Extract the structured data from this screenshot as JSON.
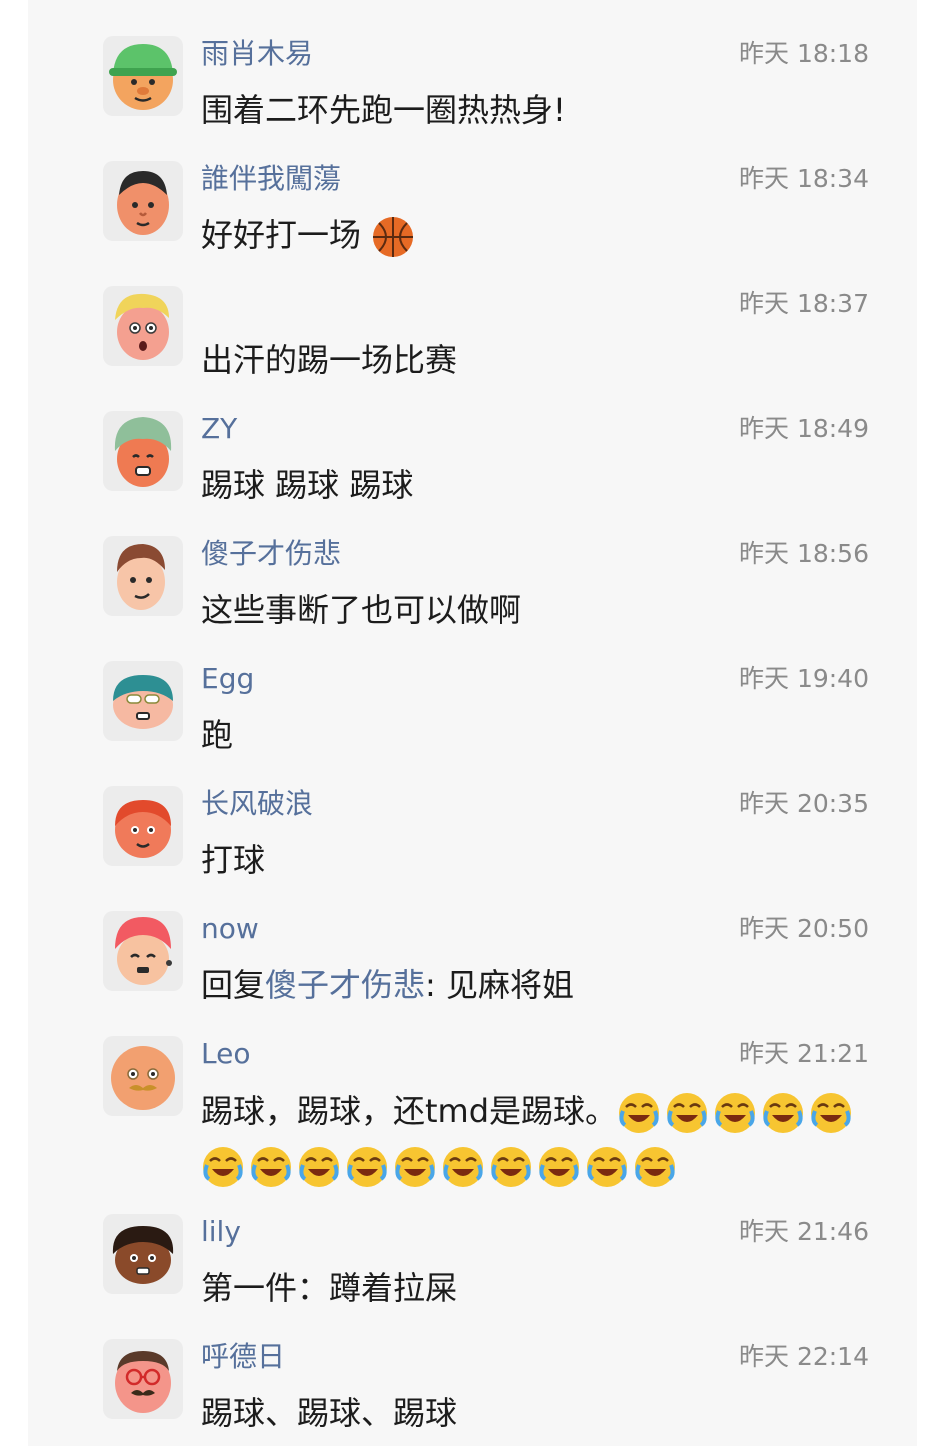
{
  "comments": [
    {
      "name": "雨肖木易",
      "time": "昨天 18:18",
      "text": "围着二环先跑一圈热热身!",
      "avatar": {
        "icon": "avatar-green-cap",
        "skin": "#f3a45f",
        "hair": "#5cc36a"
      }
    },
    {
      "name": "誰伴我闖蕩",
      "time": "昨天 18:34",
      "text": "好好打一场",
      "emoji": "basketball",
      "avatar": {
        "icon": "avatar-black-hair",
        "skin": "#f0906a",
        "hair": "#2a2a2a"
      }
    },
    {
      "name": "",
      "time": "昨天 18:37",
      "text": "出汗的踢一场比赛",
      "avatar": {
        "icon": "avatar-blonde",
        "skin": "#f4a090",
        "hair": "#f0d45a"
      }
    },
    {
      "name": "ZY",
      "time": "昨天 18:49",
      "text": "踢球 踢球 踢球",
      "avatar": {
        "icon": "avatar-turban",
        "skin": "#ef7a52",
        "hair": "#8fbf9a"
      }
    },
    {
      "name": "傻子才伤悲",
      "time": "昨天 18:56",
      "text": "这些事断了也可以做啊",
      "avatar": {
        "icon": "avatar-brown-hair",
        "skin": "#f7c5a8",
        "hair": "#8a4a32"
      }
    },
    {
      "name": "Egg",
      "time": "昨天 19:40",
      "text": "跑",
      "avatar": {
        "icon": "avatar-teal-hair",
        "skin": "#f6b9a2",
        "hair": "#2d8f93"
      }
    },
    {
      "name": "长风破浪",
      "time": "昨天 20:35",
      "text": "打球",
      "avatar": {
        "icon": "avatar-red-hair",
        "skin": "#f07a5a",
        "hair": "#e24a2c"
      }
    },
    {
      "name": "now",
      "time": "昨天 20:50",
      "reply_prefix": "回复",
      "reply_target": "傻子才伤悲",
      "reply_text": ": 见麻将姐",
      "avatar": {
        "icon": "avatar-pink-hair",
        "skin": "#f7c2a0",
        "hair": "#f25a62"
      }
    },
    {
      "name": "Leo",
      "time": "昨天 21:21",
      "text": "踢球，踢球，还tmd是踢球。",
      "emoji": "laughing-crying",
      "emoji_count": 15,
      "avatar": {
        "icon": "avatar-bald-mustache",
        "skin": "#f2a070",
        "hair": "#f2a070"
      }
    },
    {
      "name": "lily",
      "time": "昨天 21:46",
      "text": "第一件：蹲着拉屎",
      "avatar": {
        "icon": "avatar-curly-dark",
        "skin": "#8a4a2a",
        "hair": "#2a1a12"
      }
    },
    {
      "name": "呼德日",
      "time": "昨天 22:14",
      "text": "踢球、踢球、踢球",
      "avatar": {
        "icon": "avatar-glasses",
        "skin": "#f4958a",
        "hair": "#5a3a2a"
      }
    }
  ]
}
